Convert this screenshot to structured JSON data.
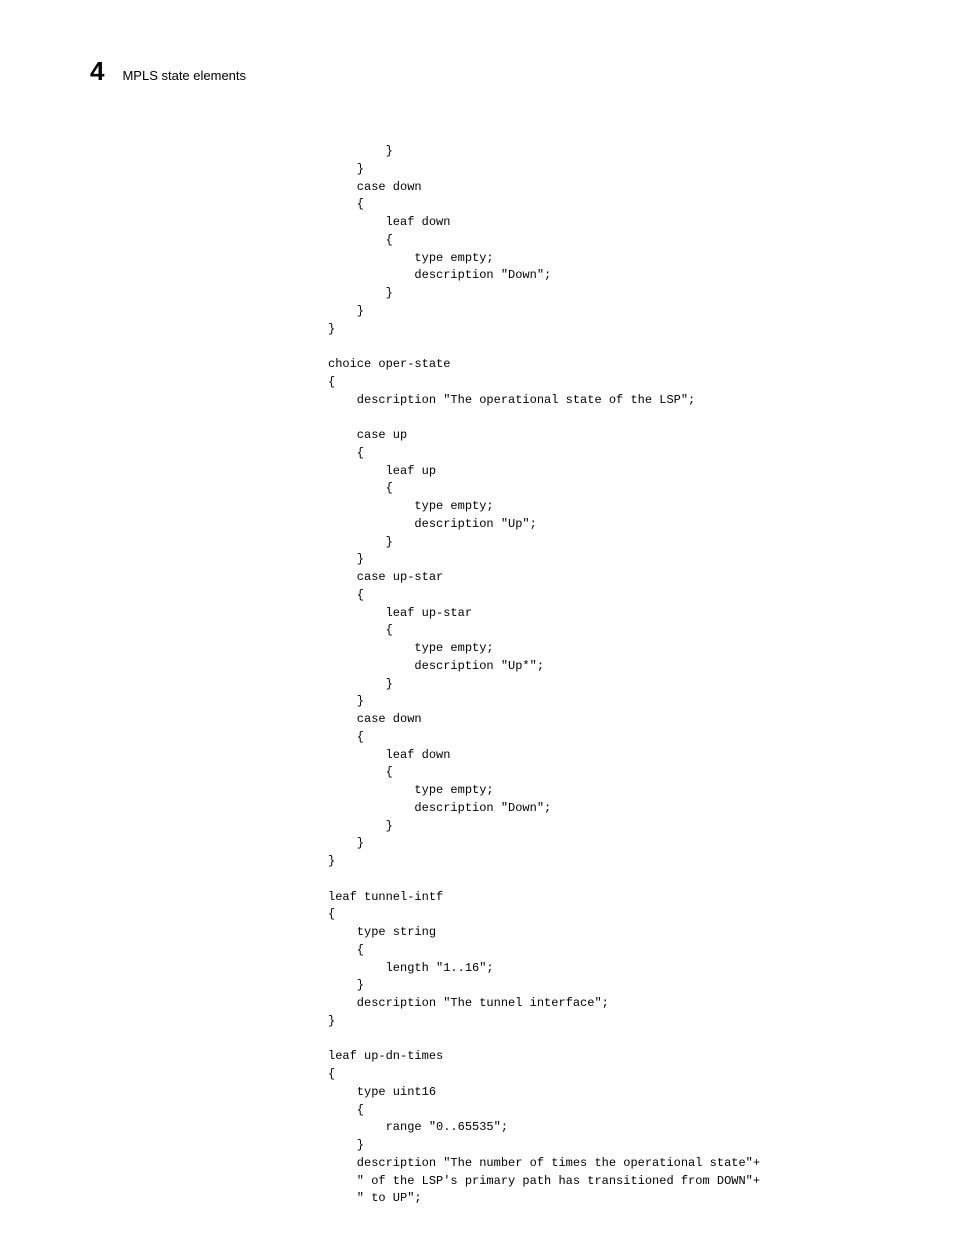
{
  "header": {
    "chapter_number": "4",
    "chapter_title": "MPLS state elements"
  },
  "code": "        }\n    }\n    case down\n    {\n        leaf down\n        {\n            type empty;\n            description \"Down\";\n        }\n    }\n}\n\nchoice oper-state\n{\n    description \"The operational state of the LSP\";\n\n    case up\n    {\n        leaf up\n        {\n            type empty;\n            description \"Up\";\n        }\n    }\n    case up-star\n    {\n        leaf up-star\n        {\n            type empty;\n            description \"Up*\";\n        }\n    }\n    case down\n    {\n        leaf down\n        {\n            type empty;\n            description \"Down\";\n        }\n    }\n}\n\nleaf tunnel-intf\n{\n    type string\n    {\n        length \"1..16\";\n    }\n    description \"The tunnel interface\";\n}\n\nleaf up-dn-times\n{\n    type uint16\n    {\n        range \"0..65535\";\n    }\n    description \"The number of times the operational state\"+\n    \" of the LSP's primary path has transitioned from DOWN\"+\n    \" to UP\";"
}
